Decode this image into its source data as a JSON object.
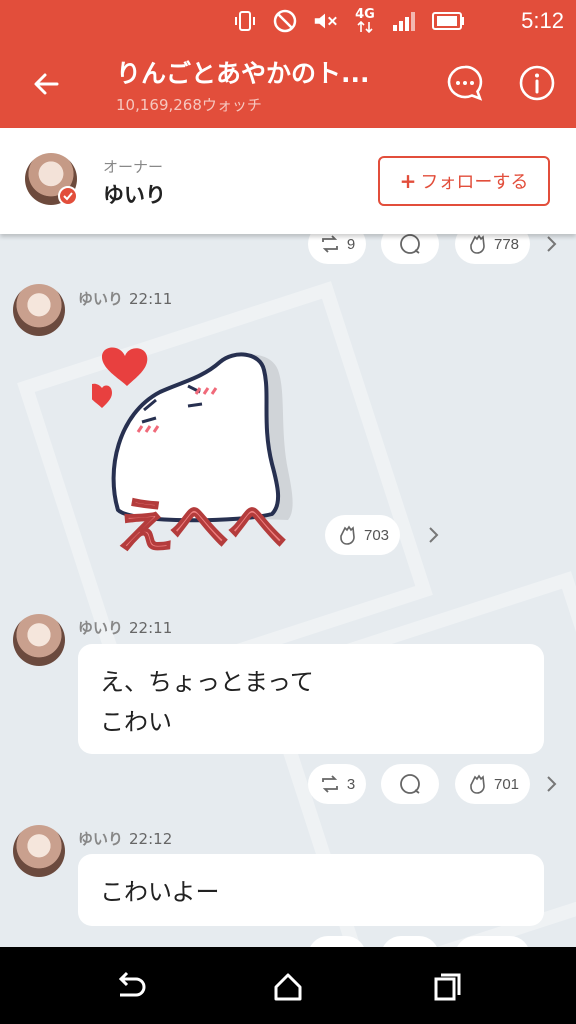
{
  "status_bar": {
    "network": "4G",
    "time": "5:12"
  },
  "header": {
    "title": "りんごとあやかのト...",
    "watch_count": "10,169,268ウォッチ"
  },
  "owner": {
    "role": "オーナー",
    "name": "ゆいり",
    "follow_label": "フォローする",
    "follow_prefix": "+"
  },
  "top_reactions": {
    "retweet_count": "9",
    "clap_count": "778"
  },
  "messages": [
    {
      "author": "ゆいり",
      "time": "22:11",
      "type": "sticker",
      "sticker_text": "えへへ",
      "clap_count": "703"
    },
    {
      "author": "ゆいり",
      "time": "22:11",
      "type": "text",
      "lines": [
        "え、ちょっとまって",
        "こわい"
      ],
      "retweet_count": "3",
      "clap_count": "701"
    },
    {
      "author": "ゆいり",
      "time": "22:12",
      "type": "text",
      "lines": [
        "こわいよー"
      ]
    }
  ],
  "colors": {
    "brand": "#e24e3b",
    "background": "#e6ebef"
  },
  "icons": [
    "back-arrow-icon",
    "chat-bubble-icon",
    "info-icon",
    "retweet-icon",
    "comment-icon",
    "clap-icon",
    "chevron-right-icon",
    "nav-back-icon",
    "nav-home-icon",
    "nav-recents-icon"
  ]
}
